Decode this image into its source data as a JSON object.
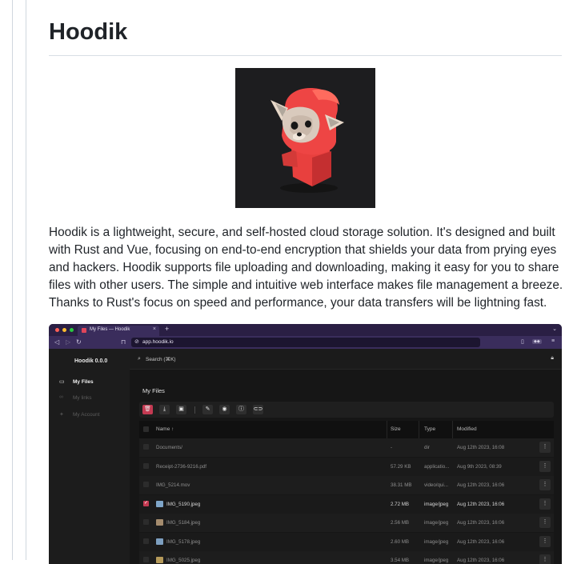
{
  "article": {
    "title": "Hoodik",
    "paragraph": "Hoodik is a lightweight, secure, and self-hosted cloud storage solution. It's designed and built with Rust and Vue, focusing on end-to-end encryption that shields your data from prying eyes and hackers. Hoodik supports file uploading and downloading, making it easy for you to share files with other users. The simple and intuitive web interface makes file management a breeze. Thanks to Rust's focus on speed and performance, your data transfers will be lightning fast."
  },
  "logo": {
    "icon": "red-hooded-fox-mascot",
    "background": "#1d1d1f",
    "hood_color": "#ee3f3f"
  },
  "screenshot": {
    "browser": {
      "tab_title": "My Files — Hoodik",
      "tab_close": "×",
      "new_tab": "+",
      "tab_menu": "⌄",
      "url": "app.hoodik.io",
      "nav_icons": [
        "back-icon",
        "forward-icon",
        "reload-icon",
        "bookmark-icon"
      ],
      "ext_badge": "◆◆"
    },
    "app": {
      "brand": "Hoodik 0.0.0",
      "sidebar": [
        {
          "label": "My Files",
          "icon": "monitor-icon",
          "active": true
        },
        {
          "label": "My links",
          "icon": "link-icon",
          "active": false
        },
        {
          "label": "My Account",
          "icon": "account-icon",
          "active": false
        }
      ],
      "search_label": "Search (⌘K)",
      "section_title": "My Files",
      "toolbar_icons": [
        "trash-icon",
        "download-icon",
        "new-folder-icon",
        "rename-icon",
        "preview-icon",
        "info-icon",
        "link-icon"
      ],
      "columns": {
        "name": "Name ↑",
        "size": "Size",
        "type": "Type",
        "modified": "Modified"
      },
      "row_action": "⋮",
      "rows": [
        {
          "name": "Documents/",
          "size": "-",
          "type": "dir",
          "modified": "Aug 12th 2023, 16:08",
          "checked": false,
          "thumb": ""
        },
        {
          "name": "Receipt-2736-9216.pdf",
          "size": "57.29 KB",
          "type": "applicatio...",
          "modified": "Aug 9th 2023, 08:39",
          "checked": false,
          "thumb": ""
        },
        {
          "name": "IMG_5214.mov",
          "size": "38.31 MB",
          "type": "video/qui...",
          "modified": "Aug 12th 2023, 16:06",
          "checked": false,
          "thumb": ""
        },
        {
          "name": "IMG_5190.jpeg",
          "size": "2.72 MB",
          "type": "image/jpeg",
          "modified": "Aug 12th 2023, 16:06",
          "checked": true,
          "thumb": "#7fa6c9"
        },
        {
          "name": "IMG_5184.jpeg",
          "size": "2.56 MB",
          "type": "image/jpeg",
          "modified": "Aug 12th 2023, 16:06",
          "checked": false,
          "thumb": "#a58c6e"
        },
        {
          "name": "IMG_5178.jpeg",
          "size": "2.60 MB",
          "type": "image/jpeg",
          "modified": "Aug 12th 2023, 16:06",
          "checked": false,
          "thumb": "#7d9fc0"
        },
        {
          "name": "IMG_5025.jpeg",
          "size": "3.54 MB",
          "type": "image/jpeg",
          "modified": "Aug 12th 2023, 16:06",
          "checked": false,
          "thumb": "#b59a5a"
        }
      ]
    }
  }
}
